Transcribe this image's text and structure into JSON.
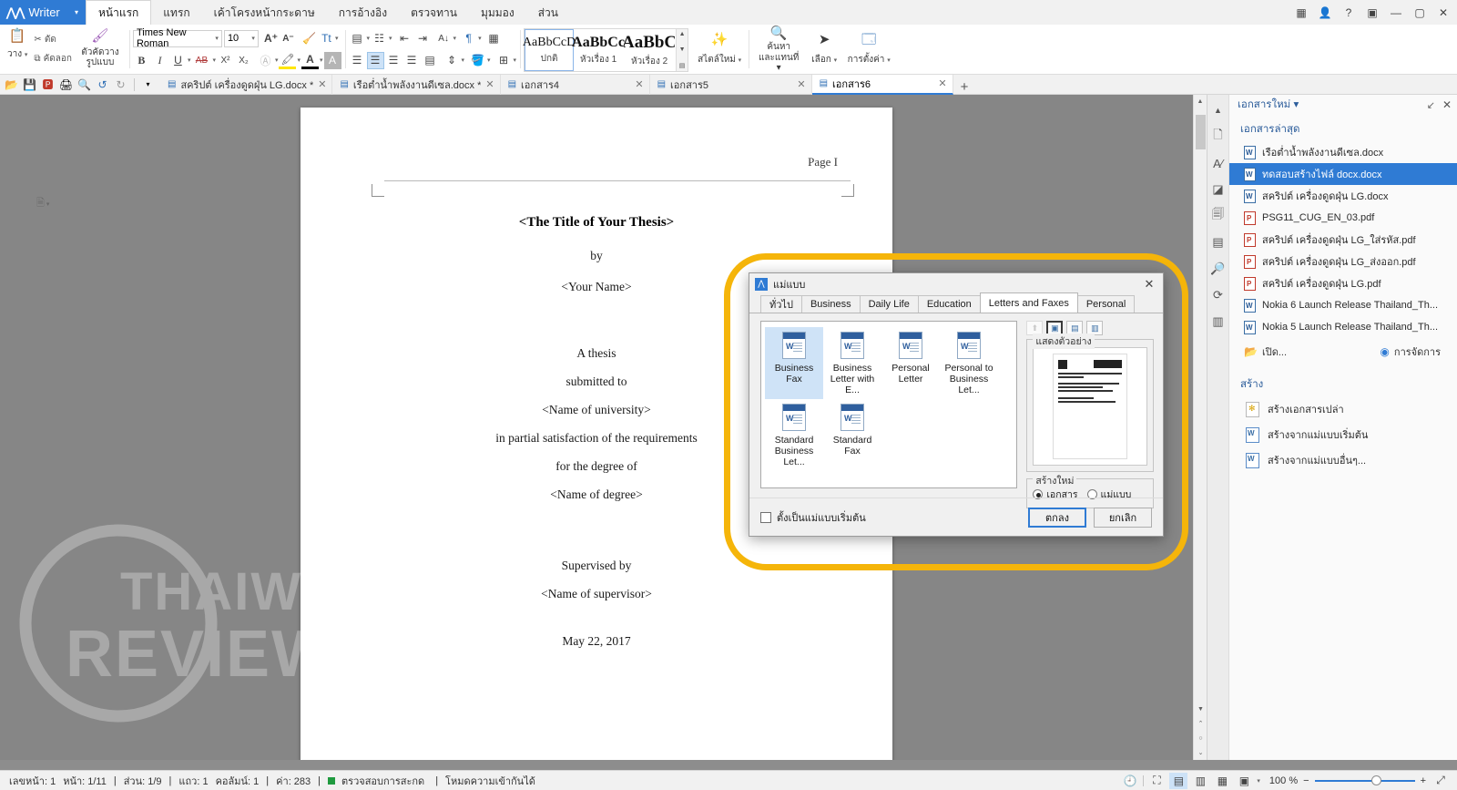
{
  "app": {
    "brand": "Writer",
    "menu_tabs": [
      {
        "label": "หน้าแรก",
        "active": true
      },
      {
        "label": "แทรก",
        "active": false
      },
      {
        "label": "เค้าโครงหน้ากระดาษ",
        "active": false
      },
      {
        "label": "การอ้างอิง",
        "active": false
      },
      {
        "label": "ตรวจทาน",
        "active": false
      },
      {
        "label": "มุมมอง",
        "active": false
      },
      {
        "label": "ส่วน",
        "active": false
      }
    ],
    "window_controls": {
      "grid": "▦",
      "user": "👤",
      "help": "?",
      "restore_pane": "▣",
      "minimize": "―",
      "maximize": "▢",
      "close": "✕"
    }
  },
  "ribbon": {
    "clipboard": {
      "paste_label": "วาง",
      "cut_label": "ตัด",
      "copy_label": "คัดลอก",
      "format_painter_label": "ตัวคัดวางรูปแบบ"
    },
    "font": {
      "family": "Times New Roman",
      "size": "10",
      "bold": "B",
      "italic": "I",
      "underline": "U",
      "strikethrough": "AB",
      "superscript": "X²",
      "subscript": "X₂",
      "grow": "A⁺",
      "shrink": "A⁻",
      "clear_format": "A",
      "text_effects": "Tt"
    },
    "paragraph": {
      "bullets": "▤",
      "numbering": "⅟☰",
      "decrease_indent": "⇤",
      "increase_indent": "⇥",
      "sort": "A↓",
      "show_marks": "¶",
      "borders_grid": "▦",
      "align_left": "≡",
      "align_center": "≡",
      "align_right": "≡",
      "justify": "≡",
      "distribute": "≡",
      "line_spacing": "↕",
      "shading": "🪣",
      "borders": "⊞"
    },
    "styles": {
      "items": [
        {
          "preview": "AaBbCcD",
          "name": "ปกติ",
          "size": "14px",
          "bold": false,
          "selected": true
        },
        {
          "preview": "AaBbCc",
          "name": "หัวเรื่อง 1",
          "size": "16px",
          "bold": true,
          "selected": false
        },
        {
          "preview": "AaBbC",
          "name": "หัวเรื่อง 2",
          "size": "18px",
          "bold": true,
          "selected": false
        }
      ],
      "new_style_label": "สไตล์ใหม่"
    },
    "editing": {
      "find_replace_label": "ค้นหา",
      "find_replace_label2": "และแทนที่",
      "select_label": "เลือก",
      "settings_label": "การตั้งค่า"
    }
  },
  "quick_tools": {
    "open": "📂",
    "save": "💾",
    "export_pdf": "🅿",
    "print": "🖨",
    "preview": "🔍",
    "undo": "↺",
    "redo": "↻",
    "more": "▾"
  },
  "doc_tabs": [
    {
      "name": "สคริปต์ เครื่องดูดฝุ่น LG.docx *",
      "active": false
    },
    {
      "name": "เรือต่ำน้ำพลังงานดีเซล.docx *",
      "active": false
    },
    {
      "name": "เอกสาร4",
      "active": false
    },
    {
      "name": "เอกสาร5",
      "active": false
    },
    {
      "name": "เอกสาร6",
      "active": true
    }
  ],
  "new_tab_glyph": "+",
  "document": {
    "header_text": "Page I",
    "title": "<The Title of Your Thesis>",
    "lines": [
      "by",
      "<Your Name>"
    ],
    "body_lines": [
      "A thesis",
      "submitted to",
      "<Name of university>",
      "in partial satisfaction of the requirements",
      "for the degree of",
      "<Name of degree>"
    ],
    "supervisor_lines": [
      "Supervised by",
      "<Name of supervisor>"
    ],
    "date": "May 22, 2017"
  },
  "sidebar": {
    "title": "เอกสารใหม่",
    "title_caret": "▾",
    "collapse_glyph": "↙",
    "close_glyph": "✕",
    "recent_heading": "เอกสารล่าสุด",
    "recent_files": [
      {
        "name": "เรือต่ำน้ำพลังงานดีเซล.docx",
        "type": "doc",
        "selected": false
      },
      {
        "name": "ทดสอบสร้างไฟล์ docx.docx",
        "type": "doc",
        "selected": true
      },
      {
        "name": "สคริปต์ เครื่องดูดฝุ่น LG.docx",
        "type": "doc",
        "selected": false
      },
      {
        "name": "PSG11_CUG_EN_03.pdf",
        "type": "pdf",
        "selected": false
      },
      {
        "name": "สคริปต์ เครื่องดูดฝุ่น LG_ใส่รหัส.pdf",
        "type": "pdf",
        "selected": false
      },
      {
        "name": "สคริปต์ เครื่องดูดฝุ่น LG_ส่งออก.pdf",
        "type": "pdf",
        "selected": false
      },
      {
        "name": "สคริปต์ เครื่องดูดฝุ่น LG.pdf",
        "type": "pdf",
        "selected": false
      },
      {
        "name": "Nokia 6 Launch Release Thailand_Th...",
        "type": "doc",
        "selected": false
      },
      {
        "name": "Nokia 5 Launch Release  Thailand_Th...",
        "type": "doc",
        "selected": false
      }
    ],
    "open_label": "เปิด...",
    "manage_label": "การจัดการ",
    "create_heading": "สร้าง",
    "create_items": [
      {
        "label": "สร้างเอกสารเปล่า",
        "icon": "blank"
      },
      {
        "label": "สร้างจากแม่แบบเริ่มต้น",
        "icon": "template"
      },
      {
        "label": "สร้างจากแม่แบบอื่นๆ...",
        "icon": "template"
      }
    ]
  },
  "dialog": {
    "title": "แม่แบบ",
    "close_glyph": "✕",
    "tabs": [
      {
        "label": "ทั่วไป",
        "active": false
      },
      {
        "label": "Business",
        "active": false
      },
      {
        "label": "Daily Life",
        "active": false
      },
      {
        "label": "Education",
        "active": false
      },
      {
        "label": "Letters and Faxes",
        "active": true
      },
      {
        "label": "Personal",
        "active": false
      }
    ],
    "templates": [
      {
        "label": "Business Fax",
        "selected": true
      },
      {
        "label": "Business Letter with E...",
        "selected": false
      },
      {
        "label": "Personal Letter",
        "selected": false
      },
      {
        "label": "Personal to Business Let...",
        "selected": false
      },
      {
        "label": "Standard Business Let...",
        "selected": false
      },
      {
        "label": "Standard Fax",
        "selected": false
      }
    ],
    "view_buttons": [
      {
        "name": "up-folder",
        "glyph": "⬆",
        "state": "disabled"
      },
      {
        "name": "large-icons",
        "glyph": "▣",
        "state": "selected"
      },
      {
        "name": "list-view",
        "glyph": "▤",
        "state": "normal"
      },
      {
        "name": "details-view",
        "glyph": "▥",
        "state": "normal"
      }
    ],
    "preview_legend": "แสดงตัวอย่าง",
    "create_legend": "สร้างใหม่",
    "create_options": [
      {
        "label": "เอกสาร",
        "checked": true
      },
      {
        "label": "แม่แบบ",
        "checked": false
      }
    ],
    "default_template_checkbox": "ตั้งเป็นแม่แบบเริ่มต้น",
    "ok_label": "ตกลง",
    "cancel_label": "ยกเลิก"
  },
  "statusbar": {
    "page_number": "เลขหน้า: 1",
    "pages": "หน้า: 1/11",
    "section": "ส่วน: 1/9",
    "row": "แถว: 1",
    "column": "คอลัมน์: 1",
    "words": "ค่า: 283",
    "spellcheck": "ตรวจสอบการสะกด",
    "compat_mode": "โหมดความเข้ากันได้",
    "zoom_level": "100 %",
    "zoom_out": "−",
    "zoom_in": "+",
    "view_icons": [
      {
        "name": "history-icon",
        "glyph": "🕘",
        "selected": false
      },
      {
        "name": "fullscreen-icon",
        "glyph": "⛶",
        "selected": false
      },
      {
        "name": "print-layout-icon",
        "glyph": "▤",
        "selected": true
      },
      {
        "name": "web-layout-icon",
        "glyph": "▥",
        "selected": false
      },
      {
        "name": "outline-icon",
        "glyph": "▦",
        "selected": false
      },
      {
        "name": "reading-icon",
        "glyph": "▣",
        "selected": false
      }
    ],
    "fit_page": "⤢"
  },
  "watermark": {
    "line1": "THAIWARE",
    "line2": "REVIEW"
  },
  "colors": {
    "accent": "#2f7bd4",
    "highlight_ring": "#f5b50a",
    "selection": "#cfe3f7",
    "status_green": "#1f9a3f"
  }
}
